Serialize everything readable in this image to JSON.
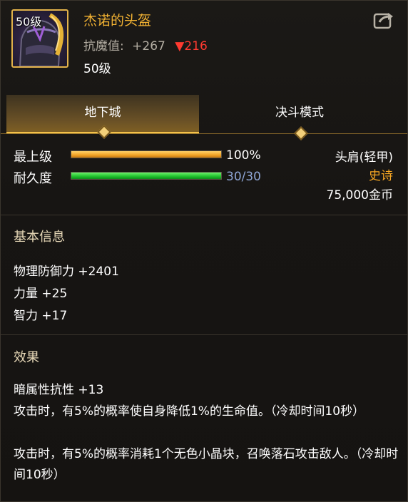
{
  "item": {
    "icon_level": "50级",
    "name": "杰诺的头盔",
    "anti_magic_label": "抗魔值:",
    "anti_magic_value": "+267",
    "anti_magic_down": "▼216",
    "level": "50级"
  },
  "tabs": [
    {
      "label": "地下城",
      "active": true
    },
    {
      "label": "决斗模式",
      "active": false
    }
  ],
  "stats": {
    "upgrade_label": "最上级",
    "upgrade_value": "100%",
    "upgrade_fraction": 1.0,
    "durability_label": "耐久度",
    "durability_value": "30/30",
    "durability_fraction": 1.0
  },
  "right_info": {
    "slot": "头肩(轻甲)",
    "rarity": "史诗",
    "price": "75,000金币"
  },
  "basic_info": {
    "title": "基本信息",
    "lines": [
      "物理防御力 +2401",
      "力量 +25",
      "智力 +17"
    ]
  },
  "effects": {
    "title": "效果",
    "lines": [
      "暗属性抗性 +13",
      "攻击时，有5%的概率使自身降低1%的生命值。（冷却时间10秒）",
      "攻击时，有5%的概率消耗1个无色小晶块，召唤落石攻击敌人。（冷却时间10秒）"
    ]
  },
  "colors": {
    "name_gold": "#f2b233",
    "rarity_gold": "#f5a623",
    "down_red": "#ff3a30",
    "durability_blue": "#8fa6d6",
    "frame_gold": "#e2b24a"
  },
  "icons": {
    "item_icon": "helmet-icon",
    "share_icon": "share-icon"
  }
}
